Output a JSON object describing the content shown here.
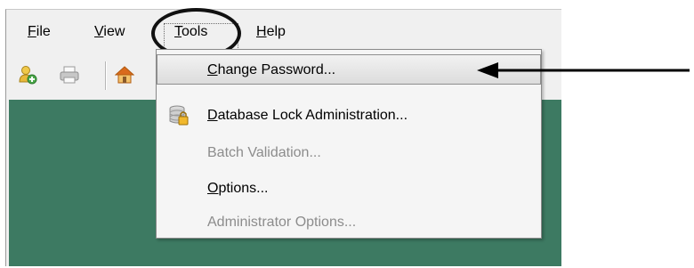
{
  "menubar": {
    "items": [
      {
        "label": "File",
        "mnemonic": "F",
        "rest": "ile"
      },
      {
        "label": "View",
        "mnemonic": "V",
        "rest": "iew"
      },
      {
        "label": "Tools",
        "mnemonic": "T",
        "rest": "ools"
      },
      {
        "label": "Help",
        "mnemonic": "H",
        "rest": "elp"
      }
    ]
  },
  "toolbar": {
    "icons": [
      "add-user-icon",
      "print-icon",
      "home-icon"
    ]
  },
  "tools_menu": {
    "items": [
      {
        "label": "Change Password...",
        "mnemonic": "C",
        "rest": "hange Password...",
        "enabled": true,
        "highlighted": true
      },
      {
        "label": "Database Lock Administration...",
        "mnemonic": "D",
        "rest": "atabase Lock Administration...",
        "enabled": true,
        "icon": "database-lock-icon"
      },
      {
        "label": "Batch Validation...",
        "enabled": false
      },
      {
        "label": "Options...",
        "mnemonic": "O",
        "rest": "ptions...",
        "enabled": true
      },
      {
        "label": "Administrator Options...",
        "enabled": false
      }
    ]
  },
  "colors": {
    "workspace": "#3d7a62",
    "menu_bg": "#f5f5f5",
    "disabled_text": "#8c8c8c",
    "annotation": "#000000"
  }
}
